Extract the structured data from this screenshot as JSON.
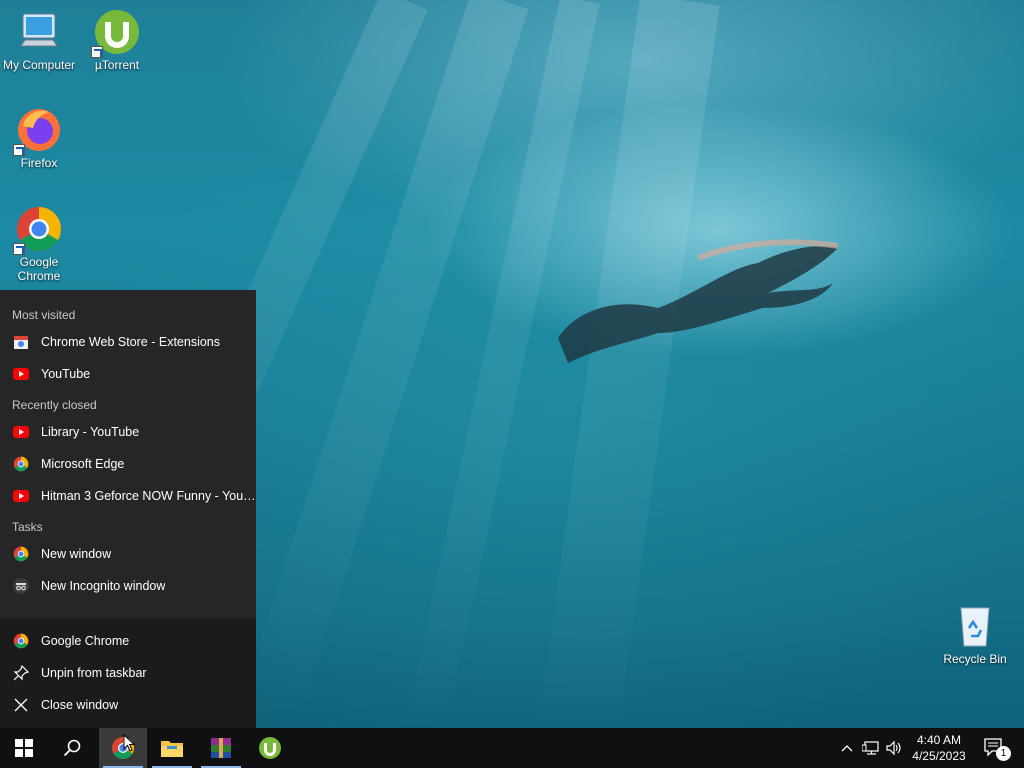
{
  "desktop": {
    "icons": [
      {
        "label": "My Computer",
        "icon": "computer-icon"
      },
      {
        "label": "µTorrent",
        "icon": "utorrent-icon"
      },
      {
        "label": "Firefox",
        "icon": "firefox-icon"
      },
      {
        "label": "Google Chrome",
        "icon": "chrome-icon"
      },
      {
        "label": "Recycle Bin",
        "icon": "recycle-bin-icon"
      }
    ]
  },
  "jump_list": {
    "most_visited_header": "Most visited",
    "most_visited": [
      {
        "label": "Chrome Web Store - Extensions",
        "icon": "chrome-web-store-icon"
      },
      {
        "label": "YouTube",
        "icon": "youtube-icon"
      }
    ],
    "recently_closed_header": "Recently closed",
    "recently_closed": [
      {
        "label": "Library - YouTube",
        "icon": "youtube-icon"
      },
      {
        "label": "Microsoft Edge",
        "icon": "chrome-icon"
      },
      {
        "label": "Hitman 3 Geforce NOW Funny - YouTu...",
        "icon": "youtube-icon"
      }
    ],
    "tasks_header": "Tasks",
    "tasks": [
      {
        "label": "New window",
        "icon": "chrome-icon"
      },
      {
        "label": "New Incognito window",
        "icon": "incognito-icon"
      }
    ],
    "actions": [
      {
        "label": "Google Chrome",
        "icon": "chrome-icon"
      },
      {
        "label": "Unpin from taskbar",
        "icon": "unpin-icon"
      },
      {
        "label": "Close window",
        "icon": "close-icon"
      }
    ]
  },
  "taskbar": {
    "buttons": [
      "start-icon",
      "search-icon",
      "chrome-icon",
      "file-explorer-icon",
      "winrar-icon",
      "utorrent-icon"
    ],
    "active": "chrome-icon",
    "tray": {
      "time": "4:40 AM",
      "date": "4/25/2023",
      "notification_count": "1"
    }
  },
  "colors": {
    "menu_bg": "#262626",
    "menu_bottom_bg": "#1b1b1b",
    "taskbar_bg": "#101010",
    "youtube_red": "#ff0000",
    "utorrent_green": "#78b83b"
  }
}
